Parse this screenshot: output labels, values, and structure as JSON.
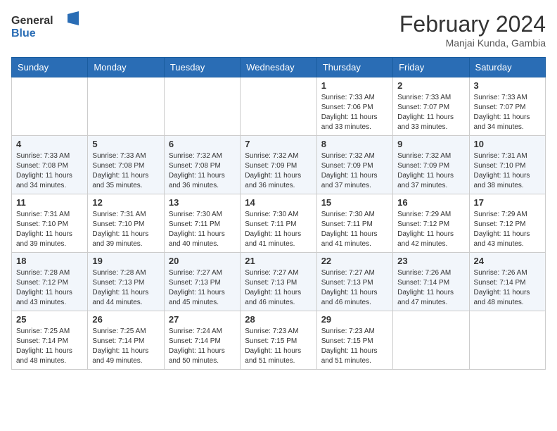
{
  "header": {
    "logo_general": "General",
    "logo_blue": "Blue",
    "month_year": "February 2024",
    "location": "Manjai Kunda, Gambia"
  },
  "weekdays": [
    "Sunday",
    "Monday",
    "Tuesday",
    "Wednesday",
    "Thursday",
    "Friday",
    "Saturday"
  ],
  "weeks": [
    [
      {
        "day": "",
        "sunrise": "",
        "sunset": "",
        "daylight": ""
      },
      {
        "day": "",
        "sunrise": "",
        "sunset": "",
        "daylight": ""
      },
      {
        "day": "",
        "sunrise": "",
        "sunset": "",
        "daylight": ""
      },
      {
        "day": "",
        "sunrise": "",
        "sunset": "",
        "daylight": ""
      },
      {
        "day": "1",
        "sunrise": "Sunrise: 7:33 AM",
        "sunset": "Sunset: 7:06 PM",
        "daylight": "Daylight: 11 hours and 33 minutes."
      },
      {
        "day": "2",
        "sunrise": "Sunrise: 7:33 AM",
        "sunset": "Sunset: 7:07 PM",
        "daylight": "Daylight: 11 hours and 33 minutes."
      },
      {
        "day": "3",
        "sunrise": "Sunrise: 7:33 AM",
        "sunset": "Sunset: 7:07 PM",
        "daylight": "Daylight: 11 hours and 34 minutes."
      }
    ],
    [
      {
        "day": "4",
        "sunrise": "Sunrise: 7:33 AM",
        "sunset": "Sunset: 7:08 PM",
        "daylight": "Daylight: 11 hours and 34 minutes."
      },
      {
        "day": "5",
        "sunrise": "Sunrise: 7:33 AM",
        "sunset": "Sunset: 7:08 PM",
        "daylight": "Daylight: 11 hours and 35 minutes."
      },
      {
        "day": "6",
        "sunrise": "Sunrise: 7:32 AM",
        "sunset": "Sunset: 7:08 PM",
        "daylight": "Daylight: 11 hours and 36 minutes."
      },
      {
        "day": "7",
        "sunrise": "Sunrise: 7:32 AM",
        "sunset": "Sunset: 7:09 PM",
        "daylight": "Daylight: 11 hours and 36 minutes."
      },
      {
        "day": "8",
        "sunrise": "Sunrise: 7:32 AM",
        "sunset": "Sunset: 7:09 PM",
        "daylight": "Daylight: 11 hours and 37 minutes."
      },
      {
        "day": "9",
        "sunrise": "Sunrise: 7:32 AM",
        "sunset": "Sunset: 7:09 PM",
        "daylight": "Daylight: 11 hours and 37 minutes."
      },
      {
        "day": "10",
        "sunrise": "Sunrise: 7:31 AM",
        "sunset": "Sunset: 7:10 PM",
        "daylight": "Daylight: 11 hours and 38 minutes."
      }
    ],
    [
      {
        "day": "11",
        "sunrise": "Sunrise: 7:31 AM",
        "sunset": "Sunset: 7:10 PM",
        "daylight": "Daylight: 11 hours and 39 minutes."
      },
      {
        "day": "12",
        "sunrise": "Sunrise: 7:31 AM",
        "sunset": "Sunset: 7:10 PM",
        "daylight": "Daylight: 11 hours and 39 minutes."
      },
      {
        "day": "13",
        "sunrise": "Sunrise: 7:30 AM",
        "sunset": "Sunset: 7:11 PM",
        "daylight": "Daylight: 11 hours and 40 minutes."
      },
      {
        "day": "14",
        "sunrise": "Sunrise: 7:30 AM",
        "sunset": "Sunset: 7:11 PM",
        "daylight": "Daylight: 11 hours and 41 minutes."
      },
      {
        "day": "15",
        "sunrise": "Sunrise: 7:30 AM",
        "sunset": "Sunset: 7:11 PM",
        "daylight": "Daylight: 11 hours and 41 minutes."
      },
      {
        "day": "16",
        "sunrise": "Sunrise: 7:29 AM",
        "sunset": "Sunset: 7:12 PM",
        "daylight": "Daylight: 11 hours and 42 minutes."
      },
      {
        "day": "17",
        "sunrise": "Sunrise: 7:29 AM",
        "sunset": "Sunset: 7:12 PM",
        "daylight": "Daylight: 11 hours and 43 minutes."
      }
    ],
    [
      {
        "day": "18",
        "sunrise": "Sunrise: 7:28 AM",
        "sunset": "Sunset: 7:12 PM",
        "daylight": "Daylight: 11 hours and 43 minutes."
      },
      {
        "day": "19",
        "sunrise": "Sunrise: 7:28 AM",
        "sunset": "Sunset: 7:13 PM",
        "daylight": "Daylight: 11 hours and 44 minutes."
      },
      {
        "day": "20",
        "sunrise": "Sunrise: 7:27 AM",
        "sunset": "Sunset: 7:13 PM",
        "daylight": "Daylight: 11 hours and 45 minutes."
      },
      {
        "day": "21",
        "sunrise": "Sunrise: 7:27 AM",
        "sunset": "Sunset: 7:13 PM",
        "daylight": "Daylight: 11 hours and 46 minutes."
      },
      {
        "day": "22",
        "sunrise": "Sunrise: 7:27 AM",
        "sunset": "Sunset: 7:13 PM",
        "daylight": "Daylight: 11 hours and 46 minutes."
      },
      {
        "day": "23",
        "sunrise": "Sunrise: 7:26 AM",
        "sunset": "Sunset: 7:14 PM",
        "daylight": "Daylight: 11 hours and 47 minutes."
      },
      {
        "day": "24",
        "sunrise": "Sunrise: 7:26 AM",
        "sunset": "Sunset: 7:14 PM",
        "daylight": "Daylight: 11 hours and 48 minutes."
      }
    ],
    [
      {
        "day": "25",
        "sunrise": "Sunrise: 7:25 AM",
        "sunset": "Sunset: 7:14 PM",
        "daylight": "Daylight: 11 hours and 48 minutes."
      },
      {
        "day": "26",
        "sunrise": "Sunrise: 7:25 AM",
        "sunset": "Sunset: 7:14 PM",
        "daylight": "Daylight: 11 hours and 49 minutes."
      },
      {
        "day": "27",
        "sunrise": "Sunrise: 7:24 AM",
        "sunset": "Sunset: 7:14 PM",
        "daylight": "Daylight: 11 hours and 50 minutes."
      },
      {
        "day": "28",
        "sunrise": "Sunrise: 7:23 AM",
        "sunset": "Sunset: 7:15 PM",
        "daylight": "Daylight: 11 hours and 51 minutes."
      },
      {
        "day": "29",
        "sunrise": "Sunrise: 7:23 AM",
        "sunset": "Sunset: 7:15 PM",
        "daylight": "Daylight: 11 hours and 51 minutes."
      },
      {
        "day": "",
        "sunrise": "",
        "sunset": "",
        "daylight": ""
      },
      {
        "day": "",
        "sunrise": "",
        "sunset": "",
        "daylight": ""
      }
    ]
  ]
}
